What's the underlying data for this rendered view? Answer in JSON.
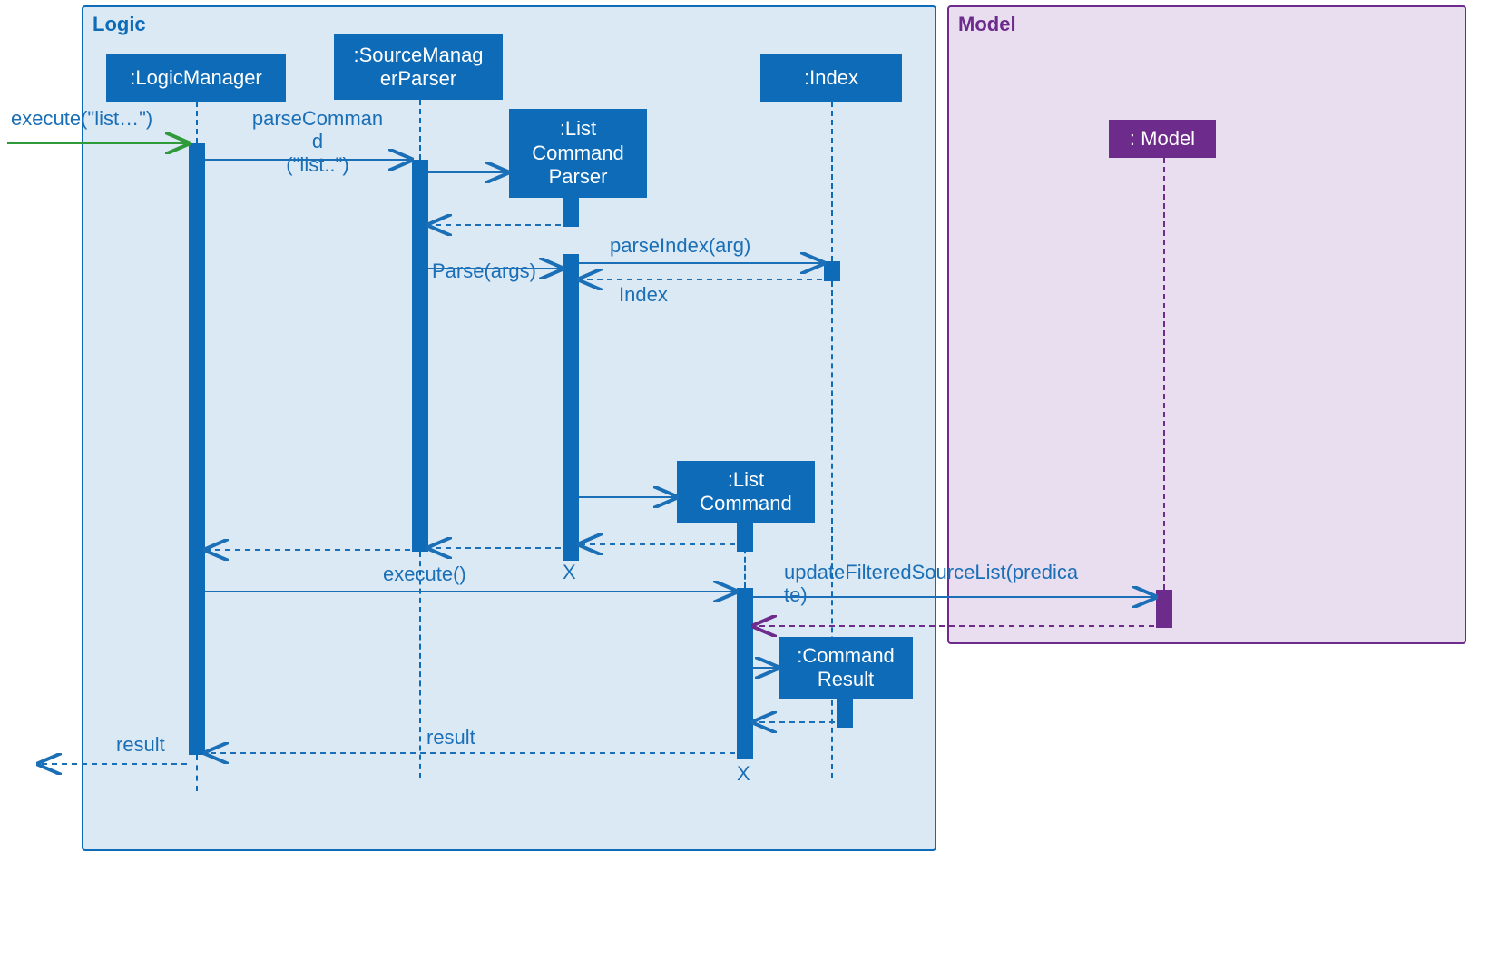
{
  "frames": {
    "logic": "Logic",
    "model": "Model"
  },
  "participants": {
    "logicManager": ":LogicManager",
    "sourceManagerParser": ":SourceManag\nerParser",
    "listCommandParser": ":List\nCommand\nParser",
    "index": ":Index",
    "listCommand": ":List\nCommand",
    "commandResult": ":Command\nResult",
    "model": ": Model"
  },
  "messages": {
    "executeIn": "execute(\"list…\")",
    "parseCommand": "parseComman\nd\n(\"list..\")",
    "parseArgs": "Parse(args)",
    "parseIndex": "parseIndex(arg)",
    "indexReturn": "Index",
    "executeCall": "execute()",
    "updateFiltered": "updateFilteredSourceList(predica\nte)",
    "resultReturn": "result",
    "resultOut": "result"
  },
  "destroy": "X"
}
